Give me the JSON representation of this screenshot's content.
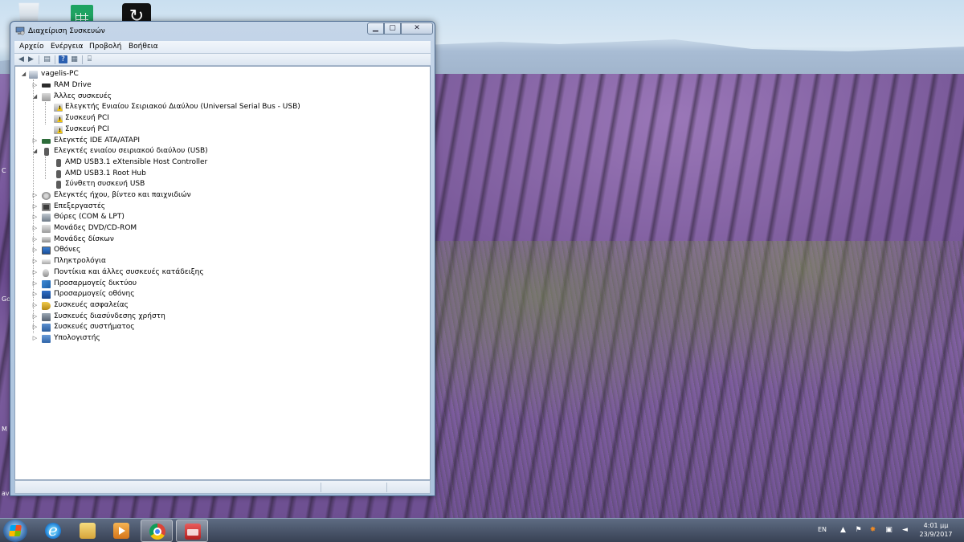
{
  "window": {
    "title": "Διαχείριση Συσκευών",
    "menu": [
      "Αρχείο",
      "Ενέργεια",
      "Προβολή",
      "Βοήθεια"
    ]
  },
  "tree": {
    "root": "vagelis-PC",
    "items": [
      {
        "label": "RAM Drive",
        "level": 1,
        "expander": "collapsed",
        "icon": "ram-icon"
      },
      {
        "label": "Άλλες συσκευές",
        "level": 1,
        "expander": "expanded",
        "icon": "other-devices-icon"
      },
      {
        "label": "Ελεγκτής Ενιαίου Σειριακού Διαύλου (Universal Serial Bus - USB)",
        "level": 2,
        "expander": "none",
        "icon": "warning-device-icon"
      },
      {
        "label": "Συσκευή PCI",
        "level": 2,
        "expander": "none",
        "icon": "warning-device-icon"
      },
      {
        "label": "Συσκευή PCI",
        "level": 2,
        "expander": "none",
        "icon": "warning-device-icon"
      },
      {
        "label": "Ελεγκτές IDE ATA/ATAPI",
        "level": 1,
        "expander": "collapsed",
        "icon": "ide-controller-icon"
      },
      {
        "label": "Ελεγκτές ενιαίου σειριακού διαύλου (USB)",
        "level": 1,
        "expander": "expanded",
        "icon": "usb-icon"
      },
      {
        "label": "AMD USB3.1 eXtensible Host Controller",
        "level": 2,
        "expander": "none",
        "icon": "usb-icon"
      },
      {
        "label": "AMD USB3.1 Root Hub",
        "level": 2,
        "expander": "none",
        "icon": "usb-icon"
      },
      {
        "label": "Σύνθετη συσκευή USB",
        "level": 2,
        "expander": "none",
        "icon": "usb-icon"
      },
      {
        "label": "Ελεγκτές ήχου, βίντεο και παιχνιδιών",
        "level": 1,
        "expander": "collapsed",
        "icon": "sound-icon"
      },
      {
        "label": "Επεξεργαστές",
        "level": 1,
        "expander": "collapsed",
        "icon": "processor-icon"
      },
      {
        "label": "Θύρες (COM & LPT)",
        "level": 1,
        "expander": "collapsed",
        "icon": "port-icon"
      },
      {
        "label": "Μονάδες DVD/CD-ROM",
        "level": 1,
        "expander": "collapsed",
        "icon": "dvd-icon"
      },
      {
        "label": "Μονάδες δίσκων",
        "level": 1,
        "expander": "collapsed",
        "icon": "disk-drive-icon"
      },
      {
        "label": "Οθόνες",
        "level": 1,
        "expander": "collapsed",
        "icon": "monitor-icon"
      },
      {
        "label": "Πληκτρολόγια",
        "level": 1,
        "expander": "collapsed",
        "icon": "keyboard-icon"
      },
      {
        "label": "Ποντίκια και άλλες συσκευές κατάδειξης",
        "level": 1,
        "expander": "collapsed",
        "icon": "mouse-icon"
      },
      {
        "label": "Προσαρμογείς δικτύου",
        "level": 1,
        "expander": "collapsed",
        "icon": "network-adapter-icon"
      },
      {
        "label": "Προσαρμογείς οθόνης",
        "level": 1,
        "expander": "collapsed",
        "icon": "display-adapter-icon"
      },
      {
        "label": "Συσκευές ασφαλείας",
        "level": 1,
        "expander": "collapsed",
        "icon": "security-key-icon"
      },
      {
        "label": "Συσκευές διασύνδεσης χρήστη",
        "level": 1,
        "expander": "collapsed",
        "icon": "hid-icon"
      },
      {
        "label": "Συσκευές συστήματος",
        "level": 1,
        "expander": "collapsed",
        "icon": "system-devices-icon"
      },
      {
        "label": "Υπολογιστής",
        "level": 1,
        "expander": "collapsed",
        "icon": "computer-icon"
      }
    ]
  },
  "taskbar": {
    "language": "EN",
    "clock_time": "4:01 μμ",
    "clock_date": "23/9/2017",
    "apps": [
      "internet-explorer",
      "file-explorer",
      "media-player",
      "chrome",
      "device-manager"
    ]
  },
  "desktop": {
    "edge_letters": [
      "C",
      "Go",
      "M",
      "av"
    ]
  },
  "colors": {
    "window_frame": "#a9c1dc",
    "taskbar": "#2d374b",
    "warning": "#f3c60e"
  }
}
